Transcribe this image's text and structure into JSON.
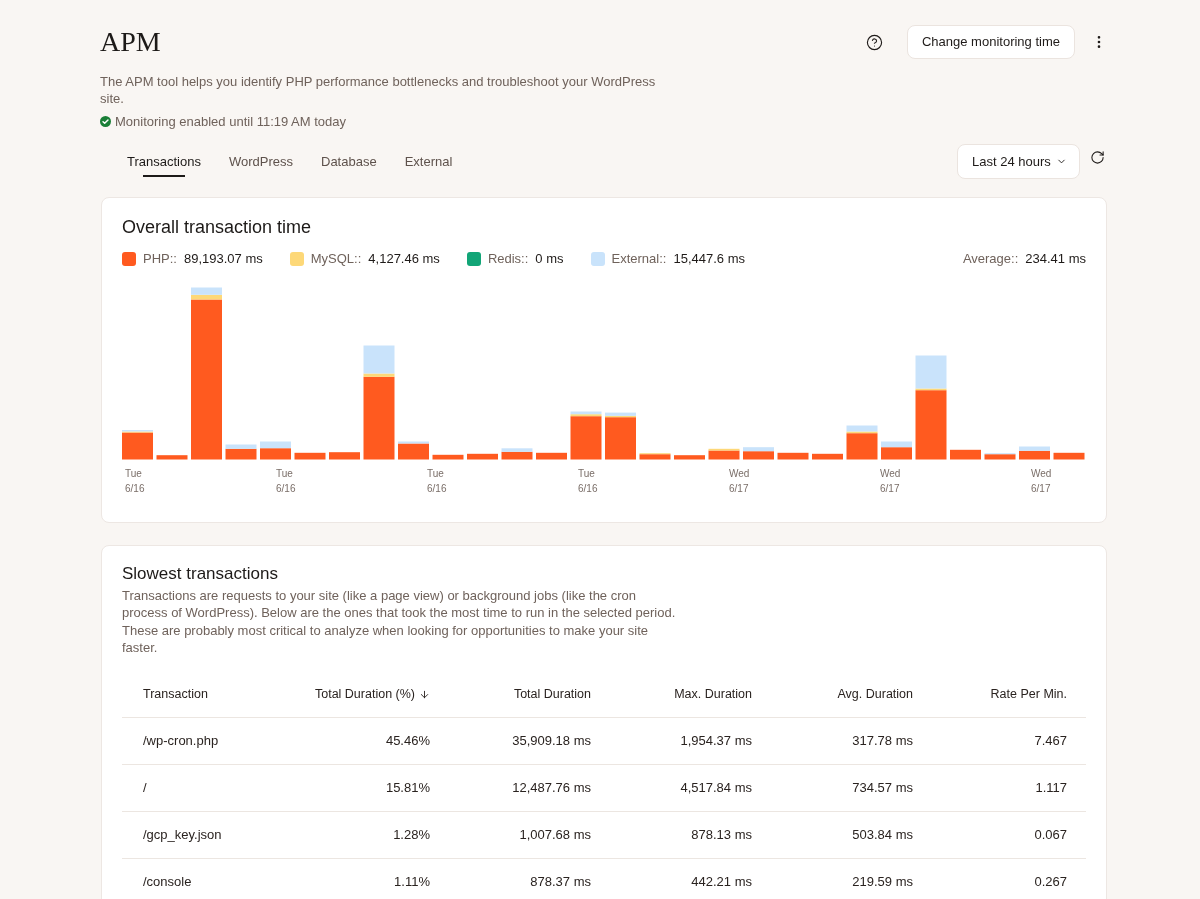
{
  "header": {
    "title": "APM",
    "action_button": "Change monitoring time",
    "description": "The APM tool helps you identify PHP performance bottlenecks and troubleshoot your WordPress site.",
    "status": "Monitoring enabled until 11:19 AM today"
  },
  "tabs": [
    {
      "label": "Transactions",
      "selected": true
    },
    {
      "label": "WordPress",
      "selected": false
    },
    {
      "label": "Database",
      "selected": false
    },
    {
      "label": "External",
      "selected": false
    }
  ],
  "period_select": {
    "value": "Last 24 hours"
  },
  "overview_card": {
    "title": "Overall transaction time",
    "legend": [
      {
        "label": "PHP::",
        "value": "89,193.07 ms",
        "color": "#ff5a1f"
      },
      {
        "label": "MySQL::",
        "value": "4,127.46 ms",
        "color": "#fdd878"
      },
      {
        "label": "Redis::",
        "value": "0 ms",
        "color": "#12a577"
      },
      {
        "label": "External::",
        "value": "15,447.6 ms",
        "color": "#c9e3fb"
      }
    ],
    "average": {
      "label": "Average::",
      "value": "234.41 ms"
    },
    "axis_labels": [
      "Tue 6/16",
      "Tue 6/16",
      "Tue 6/16",
      "Tue 6/16",
      "Wed 6/17",
      "Wed 6/17",
      "Wed 6/17"
    ]
  },
  "slowest_card": {
    "title": "Slowest transactions",
    "description": "Transactions are requests to your site (like a page view) or background jobs (like the cron process of WordPress). Below are the ones that took the most time to run in the selected period. These are probably most critical to analyze when looking for opportunities to make your site faster.",
    "table": {
      "columns": [
        {
          "label": "Transaction",
          "sorted": false
        },
        {
          "label": "Total Duration (%)",
          "sorted": true
        },
        {
          "label": "Total Duration",
          "sorted": false
        },
        {
          "label": "Max. Duration",
          "sorted": false
        },
        {
          "label": "Avg. Duration",
          "sorted": false
        },
        {
          "label": "Rate Per Min.",
          "sorted": false
        }
      ],
      "rows": [
        [
          "/wp-cron.php",
          "45.46%",
          "35,909.18 ms",
          "1,954.37 ms",
          "317.78 ms",
          "7.467"
        ],
        [
          "/",
          "15.81%",
          "12,487.76 ms",
          "4,517.84 ms",
          "734.57 ms",
          "1.117"
        ],
        [
          "/gcp_key.json",
          "1.28%",
          "1,007.68 ms",
          "878.13 ms",
          "503.84 ms",
          "0.067"
        ],
        [
          "/console",
          "1.11%",
          "878.37 ms",
          "442.21 ms",
          "219.59 ms",
          "0.267"
        ]
      ]
    }
  }
}
